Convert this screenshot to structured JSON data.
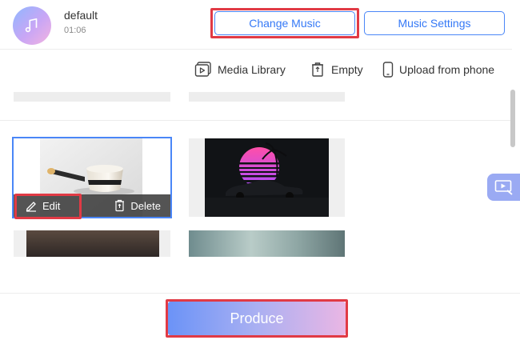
{
  "music": {
    "title": "default",
    "duration": "01:06",
    "icon": "music-note-icon"
  },
  "header": {
    "change_music": "Change Music",
    "music_settings": "Music Settings"
  },
  "toolbar": {
    "media_library": "Media Library",
    "empty": "Empty",
    "upload_from_phone": "Upload from phone"
  },
  "media_card": {
    "edit": "Edit",
    "delete": "Delete"
  },
  "footer": {
    "produce": "Produce"
  },
  "colors": {
    "accent": "#3478f6",
    "highlight": "#e13a45"
  }
}
